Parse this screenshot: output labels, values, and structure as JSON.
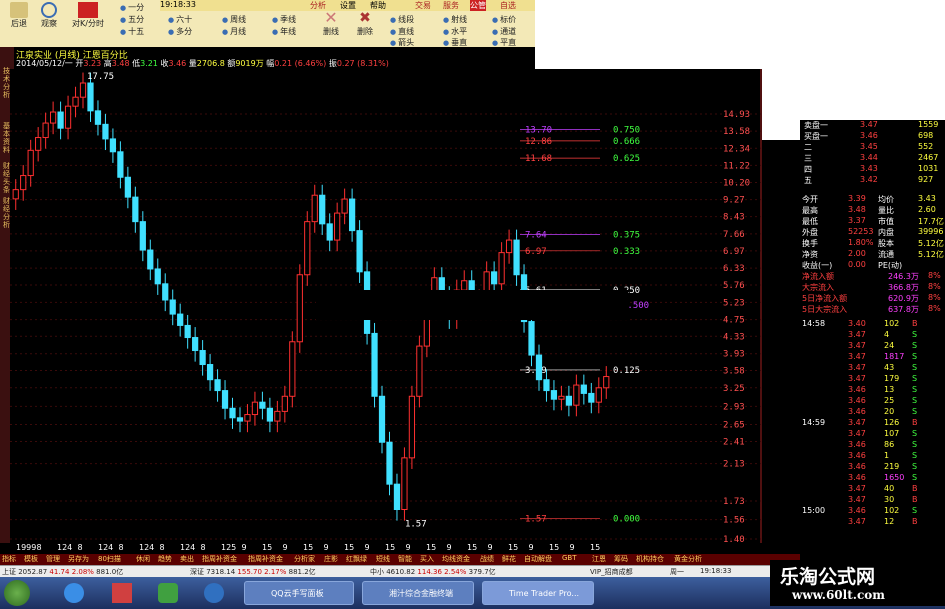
{
  "clock": "19:18:33",
  "menu_tabs": [
    "分析",
    "设置",
    "帮助"
  ],
  "right_tabs": [
    "交易",
    "服务",
    "公管",
    "自选"
  ],
  "toolbar": {
    "back": "后退",
    "view": "观察",
    "chart_switch": "对K/分时",
    "delete_label": "删线",
    "erase": "删除",
    "options_col1": [
      "一分",
      "五分",
      "十五"
    ],
    "options_col2": [
      "三十",
      "六十",
      "多分"
    ],
    "options_col3": [
      "日线",
      "周线",
      "月线"
    ],
    "options_col4": [
      "多日",
      "季线",
      "年线"
    ],
    "options_col5": [
      "线段",
      "直线",
      "箭头"
    ],
    "options_col6": [
      "射线",
      "水平",
      "垂直"
    ],
    "options_col7": [
      "标价",
      "通道",
      "平直"
    ]
  },
  "stock": {
    "title": "江泉实业 (月线) 江恩百分比",
    "date": "2014/05/12/一",
    "open": "3.23",
    "high": "3.48",
    "low": "3.21",
    "close": "3.46",
    "volume": "2706.8",
    "amount": "9019万",
    "change": "0.21 (6.46%)",
    "amplitude": "0.27 (8.31%)",
    "labels": {
      "open": "开",
      "high": "高",
      "low": "低",
      "close": "收",
      "volume": "量",
      "amount": "额",
      "change": "幅",
      "amplitude": "振"
    }
  },
  "left_vtabs": [
    "技术分析",
    "基本资料",
    "财经头条",
    "财经分析"
  ],
  "chart_data": {
    "type": "candlestick",
    "title": "江泉实业 (月线) 江恩百分比",
    "y_ticks": [
      14.93,
      13.58,
      12.34,
      11.22,
      10.2,
      9.27,
      8.43,
      7.66,
      6.97,
      6.33,
      5.76,
      5.23,
      4.75,
      4.33,
      3.93,
      3.58,
      3.25,
      2.93,
      2.65,
      2.41,
      2.13,
      1.73,
      1.56,
      1.4
    ],
    "x_ticks": [
      "1999",
      "8",
      "124",
      "8",
      "124",
      "8",
      "124",
      "8",
      "124",
      "8",
      "125",
      "9",
      "15",
      "9",
      "15",
      "9",
      "15",
      "9",
      "15",
      "9",
      "15",
      "9",
      "15",
      "9",
      "15",
      "9",
      "15",
      "9",
      "15"
    ],
    "peak_label": "17.75",
    "low_label": "1.57",
    "gann_levels": [
      {
        "price": "13.70",
        "pct": "0.750",
        "color": "#c040ff"
      },
      {
        "price": "12.86",
        "pct": "0.666",
        "color": "#ff4040"
      },
      {
        "price": "11.68",
        "pct": "0.625",
        "color": "#ff4040"
      },
      {
        "price": "",
        "pct": "0.500",
        "color": "#c040ff"
      },
      {
        "price": "7.64",
        "pct": "0.375",
        "color": "#c040ff"
      },
      {
        "price": "6.97",
        "pct": "0.333",
        "color": "#ff4040"
      },
      {
        "price": "5.61",
        "pct": "0.250",
        "color": "#ffffff"
      },
      {
        "price": "3.59",
        "pct": "0.125",
        "color": "#ffffff"
      },
      {
        "price": "1.57",
        "pct": "0.000",
        "color": "#ff4040"
      }
    ],
    "close_series": [
      9.8,
      10.6,
      12.2,
      13.1,
      14.2,
      15.1,
      13.8,
      15.6,
      16.4,
      17.75,
      15.2,
      14.1,
      13.0,
      12.1,
      10.5,
      9.4,
      8.2,
      7.0,
      6.3,
      5.8,
      5.3,
      4.9,
      4.6,
      4.3,
      4.0,
      3.7,
      3.4,
      3.2,
      2.9,
      2.75,
      2.7,
      2.8,
      3.0,
      2.9,
      2.7,
      2.85,
      3.1,
      4.2,
      6.1,
      8.2,
      9.5,
      8.1,
      7.4,
      8.6,
      9.3,
      7.8,
      6.2,
      4.4,
      3.1,
      2.4,
      1.9,
      1.65,
      2.2,
      3.1,
      4.1,
      5.2,
      6.0,
      5.4,
      4.8,
      5.6,
      5.9,
      5.1,
      5.3,
      6.2,
      5.8,
      6.9,
      7.4,
      6.1,
      4.7,
      3.9,
      3.4,
      3.2,
      3.05,
      3.1,
      2.95,
      3.3,
      3.15,
      3.0,
      3.25,
      3.46
    ],
    "ylim": [
      1.4,
      17.75
    ],
    "log_scale": true
  },
  "quote_panel": {
    "asks": [
      {
        "label": "卖盘一",
        "price": "3.47",
        "vol": "1559"
      },
      {
        "label": "买盘一",
        "price": "3.46",
        "vol": "698"
      },
      {
        "label": "二",
        "price": "3.45",
        "vol": "552"
      },
      {
        "label": "三",
        "price": "3.44",
        "vol": "2467"
      },
      {
        "label": "四",
        "price": "3.43",
        "vol": "1031"
      },
      {
        "label": "五",
        "price": "3.42",
        "vol": "927"
      }
    ],
    "stats": [
      {
        "l1": "今开",
        "v1": "3.39",
        "l2": "均价",
        "v2": "3.43"
      },
      {
        "l1": "最高",
        "v1": "3.48",
        "l2": "量比",
        "v2": "2.60"
      },
      {
        "l1": "最低",
        "v1": "3.37",
        "l2": "市值",
        "v2": "17.7亿"
      },
      {
        "l1": "外盘",
        "v1": "52253",
        "l2": "内盘",
        "v2": "39996"
      },
      {
        "l1": "换手",
        "v1": "1.80%",
        "l2": "股本",
        "v2": "5.12亿"
      },
      {
        "l1": "净资",
        "v1": "2.00",
        "l2": "流通",
        "v2": "5.12亿"
      },
      {
        "l1": "收益(一)",
        "v1": "0.00",
        "l2": "PE(动)",
        "v2": ""
      }
    ],
    "flows": [
      {
        "label": "净流入额",
        "val": "246.3万",
        "pct": "8%"
      },
      {
        "label": "大宗流入",
        "val": "366.8万",
        "pct": "8%"
      },
      {
        "label": "5日净流入额",
        "val": "620.9万",
        "pct": "8%"
      },
      {
        "label": "5日大宗流入",
        "val": "637.8万",
        "pct": "8%"
      }
    ],
    "ticks": [
      {
        "t": "14:58",
        "p": "3.40",
        "v": "102",
        "s": "B"
      },
      {
        "t": "",
        "p": "3.47",
        "v": "4",
        "s": "S"
      },
      {
        "t": "",
        "p": "3.47",
        "v": "24",
        "s": "S"
      },
      {
        "t": "",
        "p": "3.47",
        "v": "1817",
        "s": "S"
      },
      {
        "t": "",
        "p": "3.47",
        "v": "43",
        "s": "S"
      },
      {
        "t": "",
        "p": "3.47",
        "v": "179",
        "s": "S"
      },
      {
        "t": "",
        "p": "3.46",
        "v": "13",
        "s": "S"
      },
      {
        "t": "",
        "p": "3.46",
        "v": "25",
        "s": "S"
      },
      {
        "t": "",
        "p": "3.46",
        "v": "20",
        "s": "S"
      },
      {
        "t": "14:59",
        "p": "3.47",
        "v": "126",
        "s": "B"
      },
      {
        "t": "",
        "p": "3.47",
        "v": "107",
        "s": "S"
      },
      {
        "t": "",
        "p": "3.46",
        "v": "86",
        "s": "S"
      },
      {
        "t": "",
        "p": "3.46",
        "v": "1",
        "s": "S"
      },
      {
        "t": "",
        "p": "3.46",
        "v": "219",
        "s": "S"
      },
      {
        "t": "",
        "p": "3.46",
        "v": "1650",
        "s": "S"
      },
      {
        "t": "",
        "p": "3.47",
        "v": "40",
        "s": "B"
      },
      {
        "t": "",
        "p": "3.47",
        "v": "30",
        "s": "B"
      },
      {
        "t": "15:00",
        "p": "3.46",
        "v": "102",
        "s": "S"
      },
      {
        "t": "",
        "p": "3.47",
        "v": "12",
        "s": "B"
      }
    ]
  },
  "bottom_tabs": [
    "指标",
    "模板",
    "管理",
    "另存为",
    "80扫描",
    "休闲",
    "趋势",
    "卖出",
    "指周补资金",
    "指周补资金",
    "分析家",
    "庄影",
    "红飘绿",
    "短线",
    "智能",
    "买入",
    "均线资金",
    "战绩",
    "鲜花",
    "自动解盘",
    "GBT",
    "江恩",
    "筹码",
    "机构持仓",
    "黄金分析"
  ],
  "bottom_tabs2": [
    "扩展区",
    "关联报价",
    "资金分布",
    "资金驱动",
    "主力轨迹",
    "账户",
    "持仓",
    "委托"
  ],
  "status": {
    "sh": "上证 2052.87",
    "sh_chg": "41.74",
    "sh_pct": "2.08%",
    "sh_amt": "881.0亿",
    "sz": "深证 7318.14",
    "sz_chg": "155.70",
    "sz_pct": "2.17%",
    "sz_amt": "881.2亿",
    "zx": "中小 4610.82",
    "zx_chg": "114.36",
    "zx_pct": "2.54%",
    "zx_amt": "379.7亿",
    "vip": "VIP_招商成都",
    "day": "周一",
    "time": "19:18:33"
  },
  "taskbar": {
    "items": [
      "QQ云手写面板",
      "湘汁综合金融终端",
      "Time Trader Pro..."
    ]
  },
  "watermark": {
    "title": "乐淘公式网",
    "url": "www.60lt.com"
  }
}
